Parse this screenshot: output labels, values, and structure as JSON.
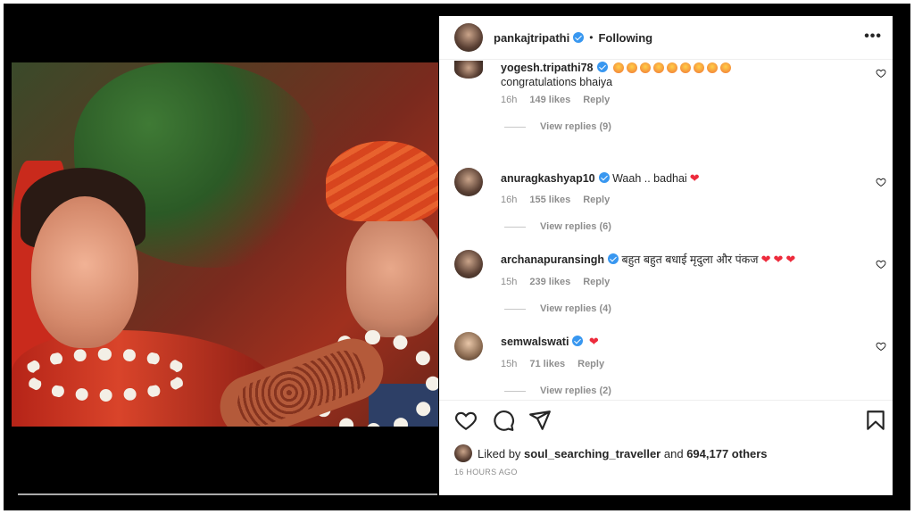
{
  "post": {
    "username": "pankajtripathi",
    "separator": "•",
    "follow_status": "Following",
    "more_label": "•••"
  },
  "comments": [
    {
      "username": "yogesh.tripathi78",
      "text": "congratulations bhaiya",
      "time": "16h",
      "likes": "149 likes",
      "reply_label": "Reply",
      "view_replies": "View replies (9)"
    },
    {
      "username": "anuragkashyap10",
      "text": "Waah .. badhai",
      "time": "16h",
      "likes": "155 likes",
      "reply_label": "Reply",
      "view_replies": "View replies (6)"
    },
    {
      "username": "archanapuransingh",
      "text": "बहुत बहुत बधाई मृदुला और पंकज",
      "time": "15h",
      "likes": "239 likes",
      "reply_label": "Reply",
      "view_replies": "View replies (4)"
    },
    {
      "username": "semwalswati",
      "text": "",
      "time": "15h",
      "likes": "71 likes",
      "reply_label": "Reply",
      "view_replies": "View replies (2)"
    }
  ],
  "likes": {
    "prefix": "Liked by",
    "user": "soul_searching_traveller",
    "connector": "and",
    "count": "694,177 others"
  },
  "timestamp": "16 HOURS AGO",
  "icons": {
    "like": "heart-icon",
    "comment": "comment-icon",
    "share": "share-icon",
    "save": "bookmark-icon",
    "verified": "verified-badge-icon"
  },
  "colors": {
    "verified_blue": "#3897f0",
    "heart_red": "#ed2b3c",
    "muted_text": "#8e8e8e"
  }
}
